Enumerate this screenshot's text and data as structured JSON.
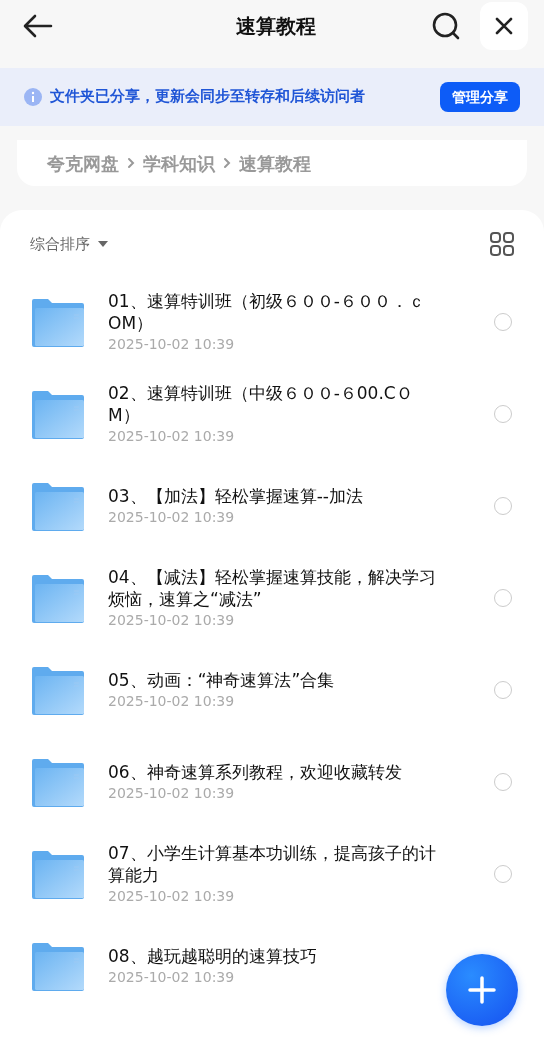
{
  "header": {
    "title": "速算教程"
  },
  "notice": {
    "text": "文件夹已分享，更新会同步至转存和后续访问者",
    "button": "管理分享"
  },
  "breadcrumb": [
    {
      "label": "夸克网盘"
    },
    {
      "label": "学科知识"
    },
    {
      "label": "速算教程"
    }
  ],
  "sort": {
    "label": "综合排序"
  },
  "files": [
    {
      "name": "01、速算特训班（初级６００-６００．ｃOM）",
      "date": "2025-10-02 10:39",
      "selected": false
    },
    {
      "name": "02、速算特训班（中级６００-６00.CＯM）",
      "date": "2025-10-02 10:39",
      "selected": false
    },
    {
      "name": "03、【加法】轻松掌握速算--加法",
      "date": "2025-10-02 10:39",
      "selected": false
    },
    {
      "name": "04、【减法】轻松掌握速算技能，解决学习烦恼，速算之“减法”",
      "date": "2025-10-02 10:39",
      "selected": false
    },
    {
      "name": "05、动画：“神奇速算法”合集",
      "date": "2025-10-02 10:39",
      "selected": false
    },
    {
      "name": "06、神奇速算系列教程，欢迎收藏转发",
      "date": "2025-10-02 10:39",
      "selected": false
    },
    {
      "name": "07、小学生计算基本功训练，提高孩子的计算能力",
      "date": "2025-10-02 10:39",
      "selected": false
    },
    {
      "name": "08、越玩越聪明的速算技巧",
      "date": "2025-10-02 10:39"
    }
  ]
}
